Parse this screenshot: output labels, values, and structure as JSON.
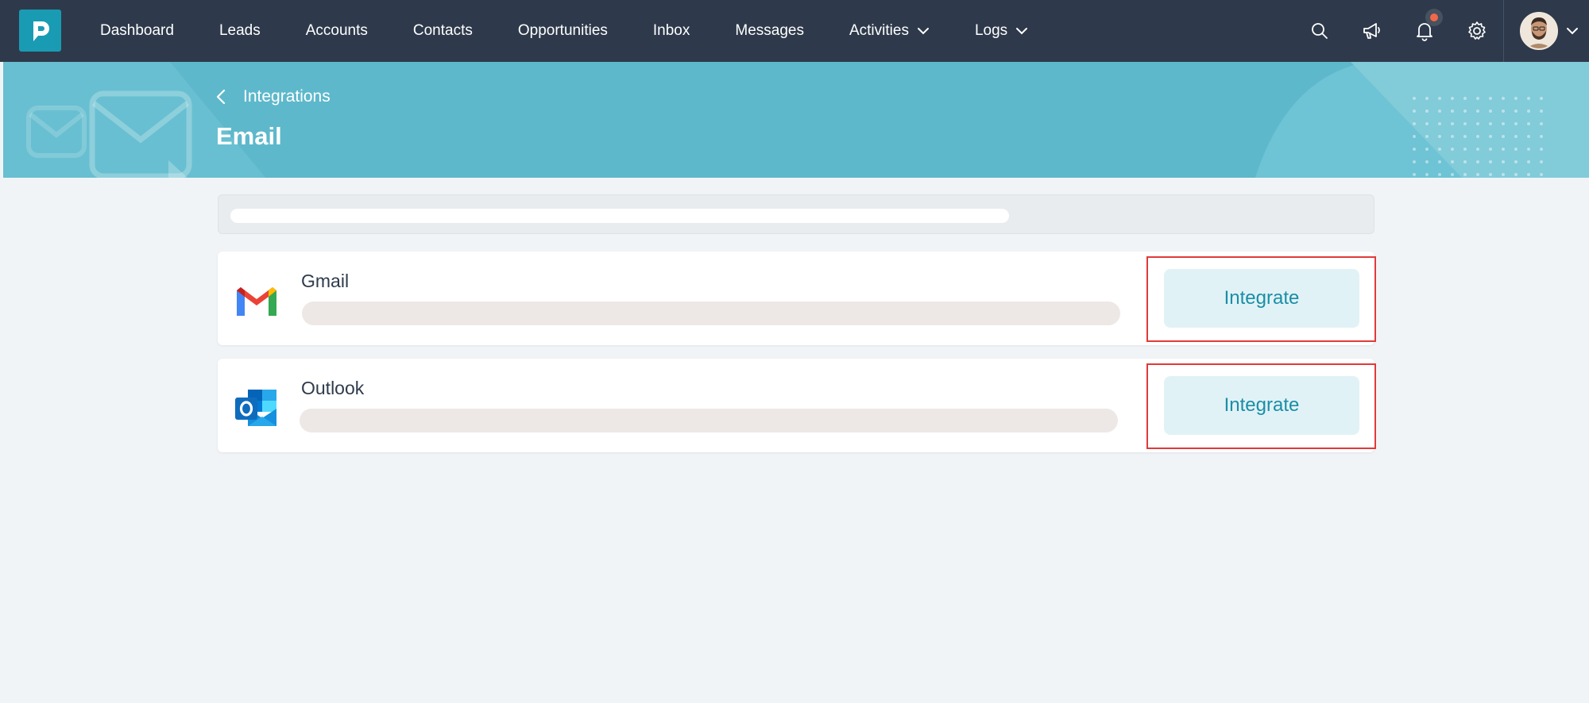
{
  "topnav": {
    "items": [
      {
        "label": "Dashboard"
      },
      {
        "label": "Leads"
      },
      {
        "label": "Accounts"
      },
      {
        "label": "Contacts"
      },
      {
        "label": "Opportunities"
      },
      {
        "label": "Inbox"
      },
      {
        "label": "Messages"
      },
      {
        "label": "Activities"
      },
      {
        "label": "Logs"
      }
    ],
    "icons": [
      "search-icon",
      "megaphone-icon",
      "bell-icon",
      "gear-icon"
    ],
    "notification_indicator": true
  },
  "header": {
    "breadcrumb": "Integrations",
    "title": "Email"
  },
  "integrations": [
    {
      "name": "Gmail",
      "action": "Integrate"
    },
    {
      "name": "Outlook",
      "action": "Integrate"
    }
  ],
  "colors": {
    "nav_bg": "#2e3a4b",
    "banner_bg": "#5eb8cb",
    "accent": "#1a9bb4",
    "button_bg": "#e1f2f6",
    "button_text": "#1a8ea6",
    "highlight": "#e03a3a"
  }
}
